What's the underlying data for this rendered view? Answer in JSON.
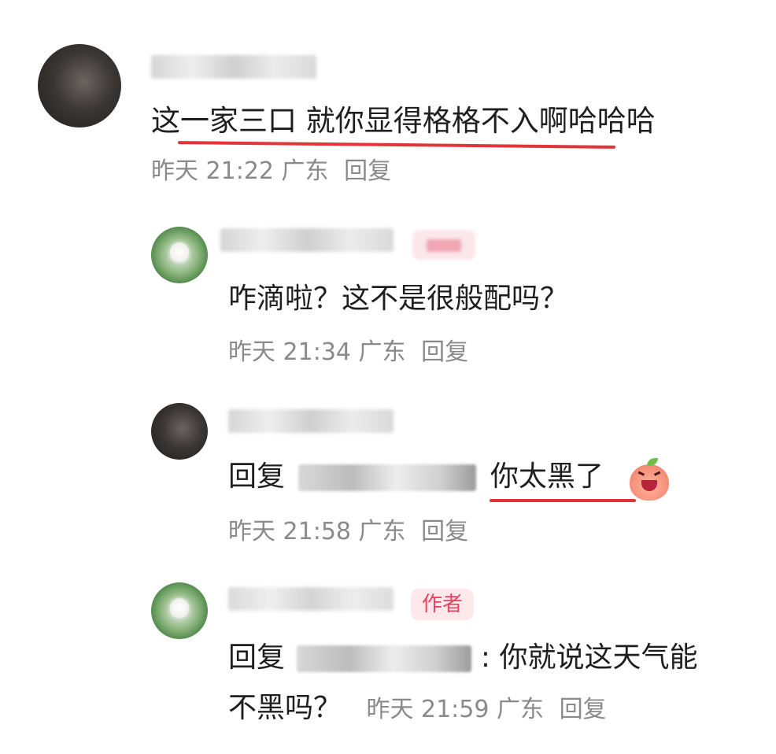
{
  "comments": [
    {
      "text": "这一家三口 就你显得格格不入啊哈哈哈",
      "time": "昨天 21:22",
      "location": "广东",
      "reply_label": "回复"
    }
  ],
  "replies": [
    {
      "text": "咋滴啦？这不是很般配吗？",
      "time": "昨天 21:34",
      "location": "广东",
      "reply_label": "回复"
    },
    {
      "prefix": "回复",
      "text": "你太黑了",
      "time": "昨天 21:58",
      "location": "广东",
      "reply_label": "回复"
    },
    {
      "author_tag": "作者",
      "prefix": "回复",
      "text_line1": ": 你就说这天气能",
      "text_line2": "不黑吗？",
      "time": "昨天 21:59",
      "location": "广东",
      "reply_label": "回复"
    }
  ],
  "colors": {
    "underline": "#e2353a",
    "author_tag_text": "#e8435c",
    "author_tag_bg": "#fde9ec"
  },
  "icons": {
    "emoji": "laughing-peach-emoji-icon"
  }
}
